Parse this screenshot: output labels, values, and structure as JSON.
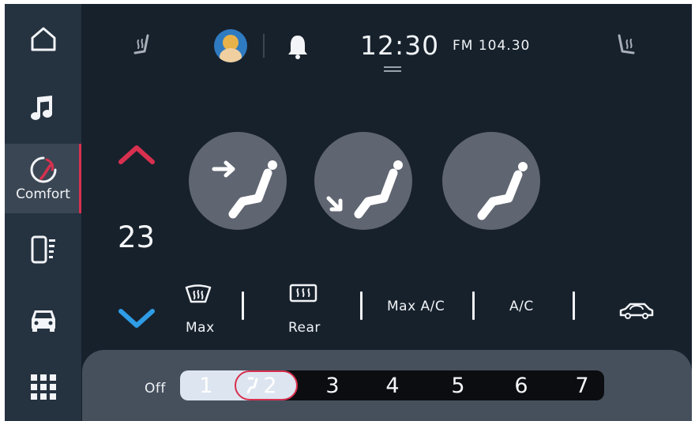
{
  "sidebar": {
    "items": [
      {
        "icon": "home-icon",
        "label": ""
      },
      {
        "icon": "music-note-icon",
        "label": ""
      },
      {
        "icon": "comfort-gauge-icon",
        "label": "Comfort",
        "active": true
      },
      {
        "icon": "phone-signal-icon",
        "label": ""
      },
      {
        "icon": "car-icon",
        "label": ""
      },
      {
        "icon": "app-grid-icon",
        "label": ""
      }
    ]
  },
  "status_bar": {
    "time": "12:30",
    "radio": "FM 104.30",
    "icons": [
      "heated-seat-left-icon",
      "avatar",
      "bell-icon",
      "heated-seat-right-icon"
    ]
  },
  "climate": {
    "temperature": "23",
    "seat_modes": [
      "seat-airflow-forward-icon",
      "seat-airflow-down-icon",
      "seat-airflow-plain-icon"
    ],
    "controls": {
      "front_defrost_label": "Max",
      "rear_defrost_label": "Rear",
      "max_ac_label": "Max A/C",
      "ac_label": "A/C",
      "recirculation_icon": "car-recirculation-icon"
    },
    "fan": {
      "off_label": "Off",
      "levels": [
        "1",
        "2",
        "3",
        "4",
        "5",
        "6",
        "7"
      ],
      "selected_level": 2
    }
  },
  "colors": {
    "background": "#17212c",
    "sidebar": "#253240",
    "accent_red": "#d8304f",
    "accent_blue": "#2f9ce6",
    "seat_button": "#5f6571",
    "fan_panel": "#46505d"
  }
}
